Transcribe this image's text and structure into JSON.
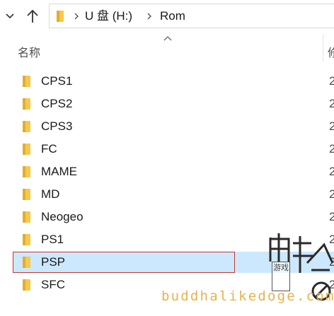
{
  "address": {
    "segments": [
      "U 盘 (H:)",
      "Rom"
    ]
  },
  "columns": {
    "name_header": "名称",
    "date_header": "修"
  },
  "items": [
    {
      "label": "CPS1",
      "date": "2",
      "selected": false
    },
    {
      "label": "CPS2",
      "date": "2",
      "selected": false
    },
    {
      "label": "CPS3",
      "date": "2",
      "selected": false
    },
    {
      "label": "FC",
      "date": "2",
      "selected": false
    },
    {
      "label": "MAME",
      "date": "2",
      "selected": false
    },
    {
      "label": "MD",
      "date": "2",
      "selected": false
    },
    {
      "label": "Neogeo",
      "date": "2",
      "selected": false
    },
    {
      "label": "PS1",
      "date": "2",
      "selected": false
    },
    {
      "label": "PSP",
      "date": "2",
      "selected": true
    },
    {
      "label": "SFC",
      "date": "2",
      "selected": false
    }
  ],
  "icons": {
    "folder": "folder-icon",
    "up": "up-arrow-icon",
    "down": "chevron-down-icon",
    "breadcrumb": "chevron-right-icon",
    "sort": "sort-ascending-icon"
  },
  "colors": {
    "selection": "#cce8ff",
    "selection_outline": "#c0392b",
    "folder": "#f5c94b",
    "watermark": "#e6b34a"
  },
  "watermark": {
    "seal_text": "游戏",
    "url_text": "buddhalikedoge.com"
  }
}
